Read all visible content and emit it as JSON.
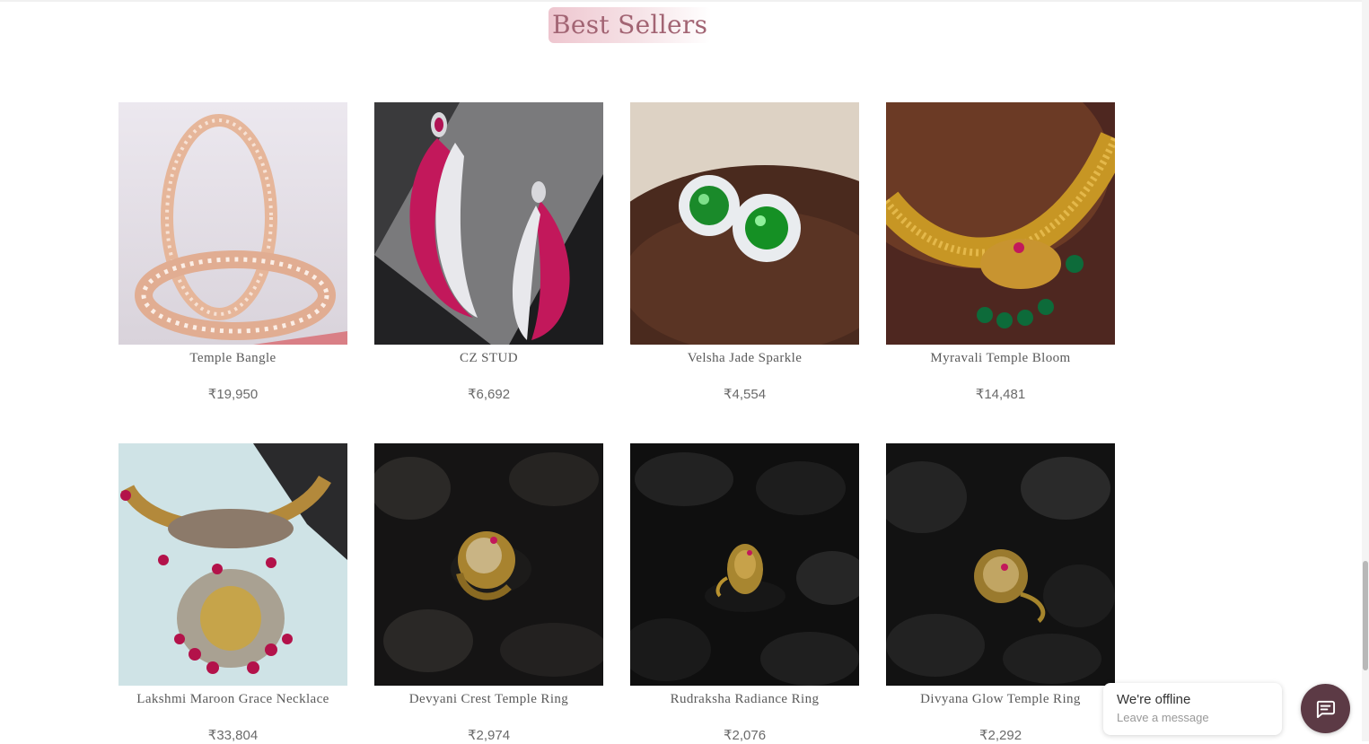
{
  "section": {
    "title": "Best Sellers"
  },
  "products": [
    {
      "name": "Temple Bangle",
      "price": "₹19,950"
    },
    {
      "name": "CZ STUD",
      "price": "₹6,692"
    },
    {
      "name": "Velsha Jade Sparkle",
      "price": "₹4,554"
    },
    {
      "name": "Myravali Temple Bloom",
      "price": "₹14,481"
    },
    {
      "name": "Lakshmi Maroon Grace Necklace",
      "price": "₹33,804"
    },
    {
      "name": "Devyani Crest Temple Ring",
      "price": "₹2,974"
    },
    {
      "name": "Rudraksha Radiance Ring",
      "price": "₹2,076"
    },
    {
      "name": "Divyana Glow Temple Ring",
      "price": "₹2,292"
    }
  ],
  "chat": {
    "status": "We're offline",
    "subtitle": "Leave a message",
    "icon": "chat-icon"
  },
  "colors": {
    "title_text": "#a26473",
    "title_bg": "#eec6cf",
    "chat_button": "#5c3a45"
  }
}
